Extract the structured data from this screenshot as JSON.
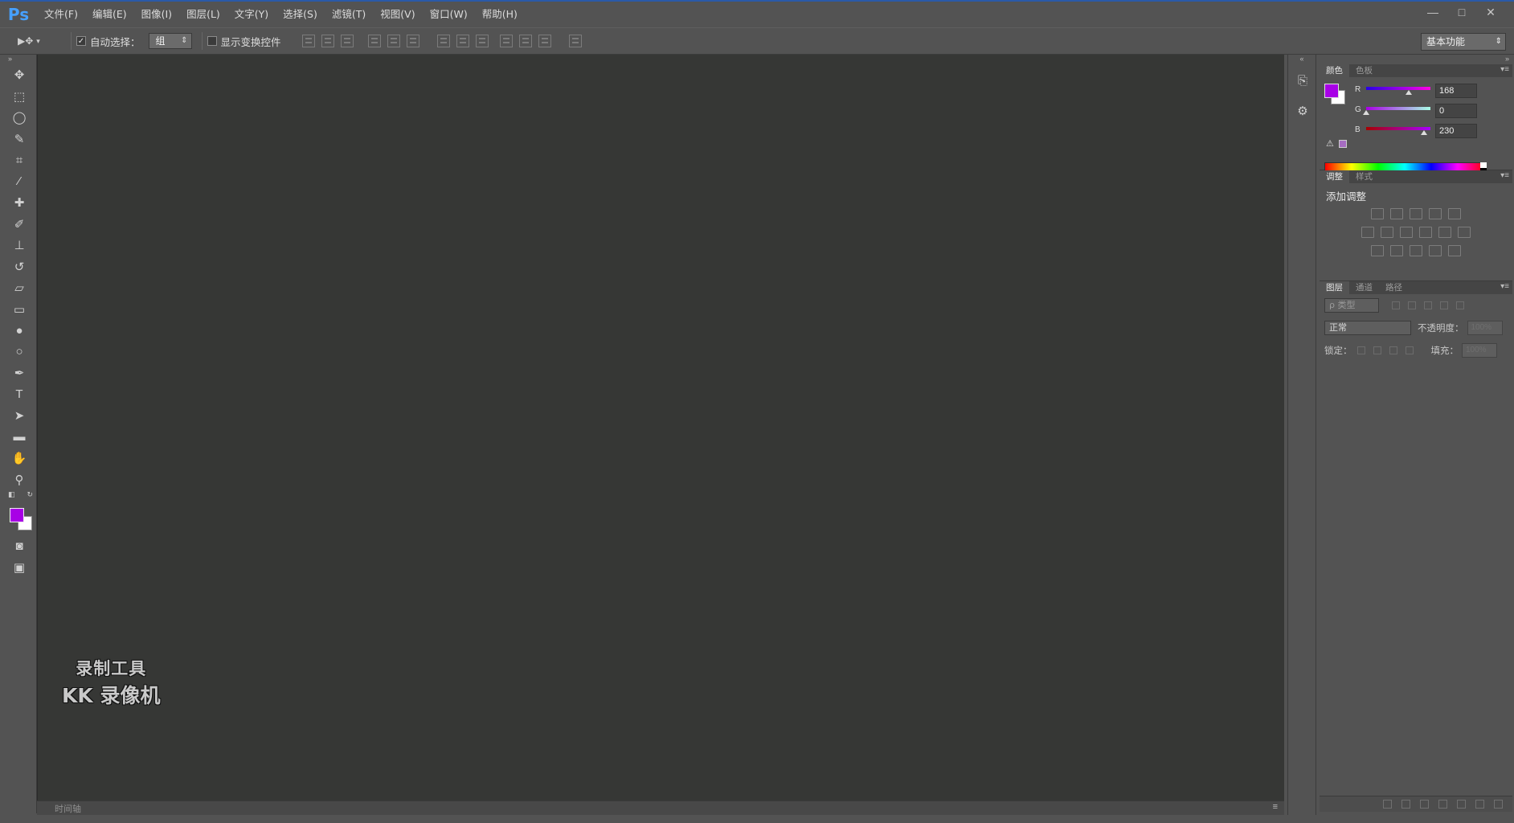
{
  "app": {
    "logo": "Ps",
    "accent": "#2a5aa8"
  },
  "menu": [
    "文件(F)",
    "编辑(E)",
    "图像(I)",
    "图层(L)",
    "文字(Y)",
    "选择(S)",
    "滤镜(T)",
    "视图(V)",
    "窗口(W)",
    "帮助(H)"
  ],
  "window_controls": {
    "minimize": "—",
    "maximize": "□",
    "close": "✕"
  },
  "options_bar": {
    "tool_icon": "move-tool-icon",
    "auto_select_label": "自动选择：",
    "auto_select_checked": true,
    "auto_select_value": "组",
    "show_transform_label": "显示变换控件",
    "show_transform_checked": false,
    "workspace": "基本功能"
  },
  "toolbox": {
    "tools": [
      {
        "name": "move",
        "glyph": "✥"
      },
      {
        "name": "marquee",
        "glyph": "⬚"
      },
      {
        "name": "lasso",
        "glyph": "◯"
      },
      {
        "name": "quick-select",
        "glyph": "✎"
      },
      {
        "name": "crop",
        "glyph": "⌗"
      },
      {
        "name": "eyedropper",
        "glyph": "⁄"
      },
      {
        "name": "healing",
        "glyph": "✚"
      },
      {
        "name": "brush",
        "glyph": "✐"
      },
      {
        "name": "stamp",
        "glyph": "⊥"
      },
      {
        "name": "history-brush",
        "glyph": "↺"
      },
      {
        "name": "eraser",
        "glyph": "▱"
      },
      {
        "name": "gradient",
        "glyph": "▭"
      },
      {
        "name": "blur",
        "glyph": "●"
      },
      {
        "name": "dodge",
        "glyph": "○"
      },
      {
        "name": "pen",
        "glyph": "✒"
      },
      {
        "name": "type",
        "glyph": "T"
      },
      {
        "name": "path-select",
        "glyph": "➤"
      },
      {
        "name": "rectangle",
        "glyph": "▬"
      },
      {
        "name": "hand",
        "glyph": "✋"
      },
      {
        "name": "zoom",
        "glyph": "⚲"
      }
    ],
    "foreground_color": "#a800e6",
    "background_color": "#ffffff"
  },
  "watermark": {
    "line1": "录制工具",
    "line2": "KK 录像机"
  },
  "timeline": {
    "tab": "时间轴"
  },
  "color_panel": {
    "tabs": [
      "颜色",
      "色板"
    ],
    "r": "168",
    "g": "0",
    "b": "230",
    "r_fraction": 0.66,
    "g_fraction": 0.0,
    "b_fraction": 0.9
  },
  "adjustments_panel": {
    "tabs": [
      "调整",
      "样式"
    ],
    "title": "添加调整"
  },
  "layers_panel": {
    "tabs": [
      "图层",
      "通道",
      "路径"
    ],
    "filter": "ρ 类型",
    "blend_mode": "正常",
    "opacity_label": "不透明度：",
    "opacity_value": "100%",
    "lock_label": "锁定：",
    "fill_label": "填充：",
    "fill_value": "100%"
  }
}
